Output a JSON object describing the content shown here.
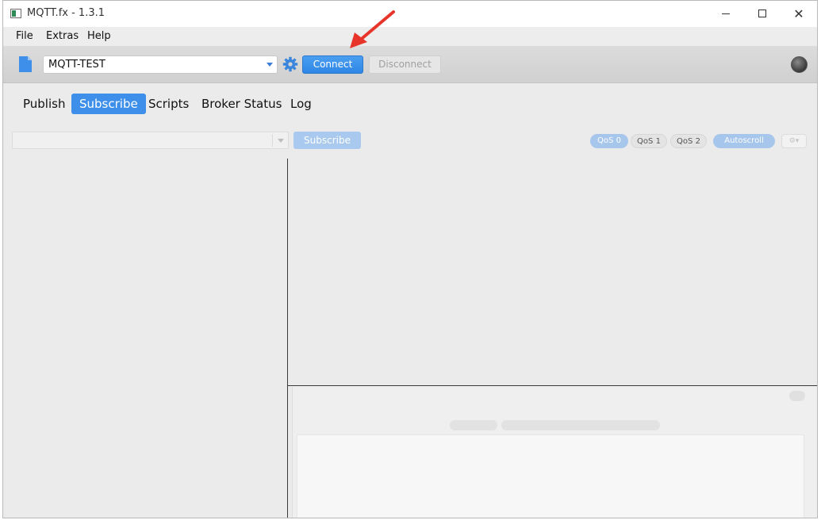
{
  "window": {
    "title": "MQTT.fx - 1.3.1",
    "min_glyph": "",
    "max_glyph": "",
    "close_glyph": "✕"
  },
  "menu": {
    "items": [
      "File",
      "Extras",
      "Help"
    ]
  },
  "toolbar": {
    "profile_value": "MQTT-TEST",
    "connect_label": "Connect",
    "disconnect_label": "Disconnect"
  },
  "tabs": [
    {
      "label": "Publish",
      "active": false
    },
    {
      "label": "Subscribe",
      "active": true
    },
    {
      "label": "Scripts",
      "active": false
    },
    {
      "label": "Broker Status",
      "active": false
    },
    {
      "label": "Log",
      "active": false
    }
  ],
  "subscribe": {
    "topic_value": "",
    "subscribe_label": "Subscribe",
    "qos_options": [
      "QoS 0",
      "QoS 1",
      "QoS 2"
    ],
    "selected_qos": "QoS 0",
    "autoscroll_label": "Autoscroll",
    "options_glyph": "⚙▾"
  },
  "colors": {
    "accent": "#3d8fea",
    "connect_button": "#2f86e6",
    "annotation_arrow": "#e8352b"
  },
  "icons": {
    "app": "mqttfx-app-icon",
    "profile": "document-icon",
    "settings": "gear-icon",
    "status": "connection-status-icon"
  }
}
